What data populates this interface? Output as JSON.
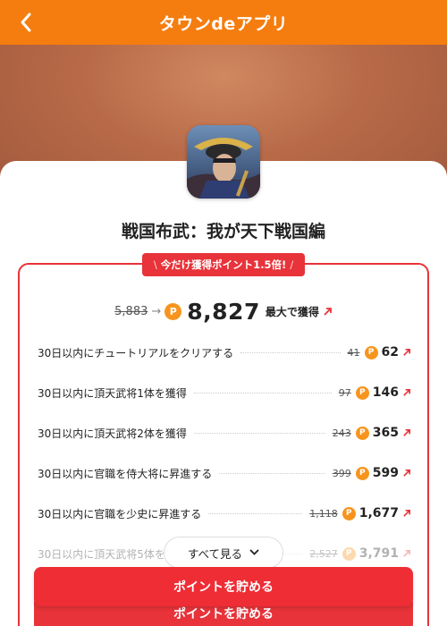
{
  "header": {
    "title": "タウンdeアプリ",
    "back_icon": "chevron-left-icon"
  },
  "app": {
    "title": "戦国布武：我が天下戦国編"
  },
  "bonus_badge": {
    "text": "今だけ獲得ポイント1.5倍!"
  },
  "total": {
    "old": "5,883",
    "new": "8,827",
    "suffix": "最大で獲得"
  },
  "tasks": [
    {
      "label": "30日以内にチュートリアルをクリアする",
      "old": "41",
      "new": "62"
    },
    {
      "label": "30日以内に頂天武将1体を獲得",
      "old": "97",
      "new": "146"
    },
    {
      "label": "30日以内に頂天武将2体を獲得",
      "old": "243",
      "new": "365"
    },
    {
      "label": "30日以内に官職を侍大将に昇進する",
      "old": "399",
      "new": "599"
    },
    {
      "label": "30日以内に官職を少史に昇進する",
      "old": "1,118",
      "new": "1,677"
    },
    {
      "label": "30日以内に頂天武将5体を",
      "old": "2,527",
      "new": "3,791"
    }
  ],
  "see_all": {
    "label": "すべて見る"
  },
  "cta": {
    "label": "ポイントを貯める"
  },
  "colors": {
    "header": "#f57d0f",
    "accent_red": "#e8333a",
    "point_orange": "#f7941d"
  }
}
